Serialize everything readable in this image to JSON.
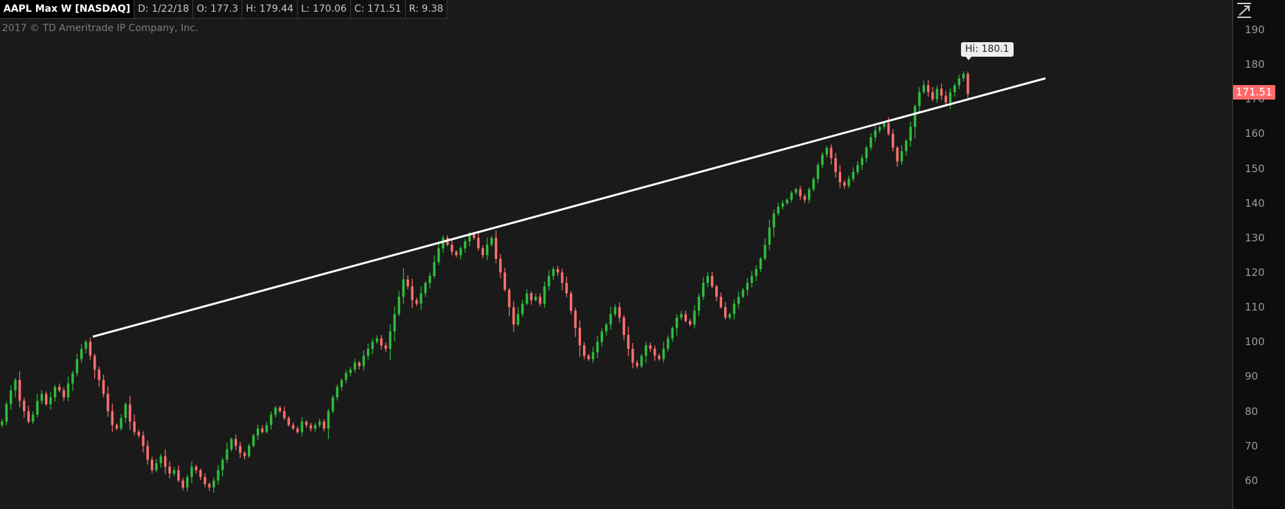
{
  "header": {
    "symbol": "AAPL Max W [NASDAQ]",
    "date": "D: 1/22/18",
    "open": "O: 177.3",
    "high": "H: 179.44",
    "low": "L: 170.06",
    "close": "C: 171.51",
    "range": "R: 9.38"
  },
  "copyright": "2017 © TD Ameritrade IP Company, Inc.",
  "icons": {
    "top_right": "expand-icon"
  },
  "chart_data": {
    "type": "candlestick",
    "ylim": [
      50,
      194
    ],
    "yticks": [
      60,
      70,
      80,
      90,
      100,
      110,
      120,
      130,
      140,
      150,
      160,
      170,
      180,
      190
    ],
    "last_price": "171.51",
    "high_annotation": "Hi: 180.1",
    "colors": {
      "up": "#2ebd3c",
      "down": "#ff7070",
      "trendline": "#ffffff",
      "last_price_badge": "#ff6b6b"
    },
    "trendline": {
      "start_value": 101.5,
      "end_value": 176.0
    },
    "closes": [
      77,
      82,
      86,
      89,
      83,
      80,
      77,
      79,
      83,
      85,
      82,
      84,
      87,
      86,
      84,
      88,
      91,
      95,
      98,
      100,
      96,
      92,
      89,
      85,
      80,
      76,
      75,
      78,
      82,
      77,
      74,
      73,
      70,
      66,
      63,
      65,
      67,
      64,
      62,
      63,
      60,
      58,
      61,
      64,
      63,
      61,
      59,
      58,
      60,
      63,
      66,
      69,
      72,
      70,
      68,
      67,
      70,
      73,
      75,
      74,
      76,
      79,
      81,
      80,
      78,
      76,
      75,
      74,
      77,
      76,
      75,
      76,
      77,
      75,
      80,
      84,
      87,
      89,
      91,
      92,
      94,
      93,
      96,
      98,
      100,
      101,
      99,
      98,
      103,
      108,
      113,
      118,
      116,
      112,
      111,
      114,
      117,
      119,
      123,
      127,
      130,
      128,
      126,
      125,
      127,
      129,
      131,
      130,
      127,
      125,
      128,
      130,
      124,
      120,
      115,
      110,
      105,
      108,
      111,
      114,
      112,
      113,
      111,
      116,
      119,
      121,
      120,
      117,
      114,
      109,
      104,
      99,
      96,
      95,
      97,
      100,
      103,
      105,
      108,
      110,
      107,
      102,
      98,
      94,
      93,
      96,
      99,
      98,
      96,
      95,
      98,
      101,
      104,
      107,
      108,
      106,
      105,
      109,
      113,
      117,
      119,
      116,
      113,
      110,
      107,
      108,
      111,
      113,
      115,
      117,
      119,
      121,
      124,
      128,
      133,
      137,
      139,
      140,
      141,
      143,
      144,
      142,
      141,
      144,
      147,
      151,
      154,
      156,
      153,
      149,
      146,
      145,
      147,
      149,
      151,
      153,
      156,
      159,
      161,
      162,
      163,
      160,
      156,
      152,
      155,
      158,
      162,
      168,
      172,
      174,
      172,
      170,
      173,
      171,
      169,
      172,
      174,
      176,
      177.3,
      171.51
    ]
  }
}
